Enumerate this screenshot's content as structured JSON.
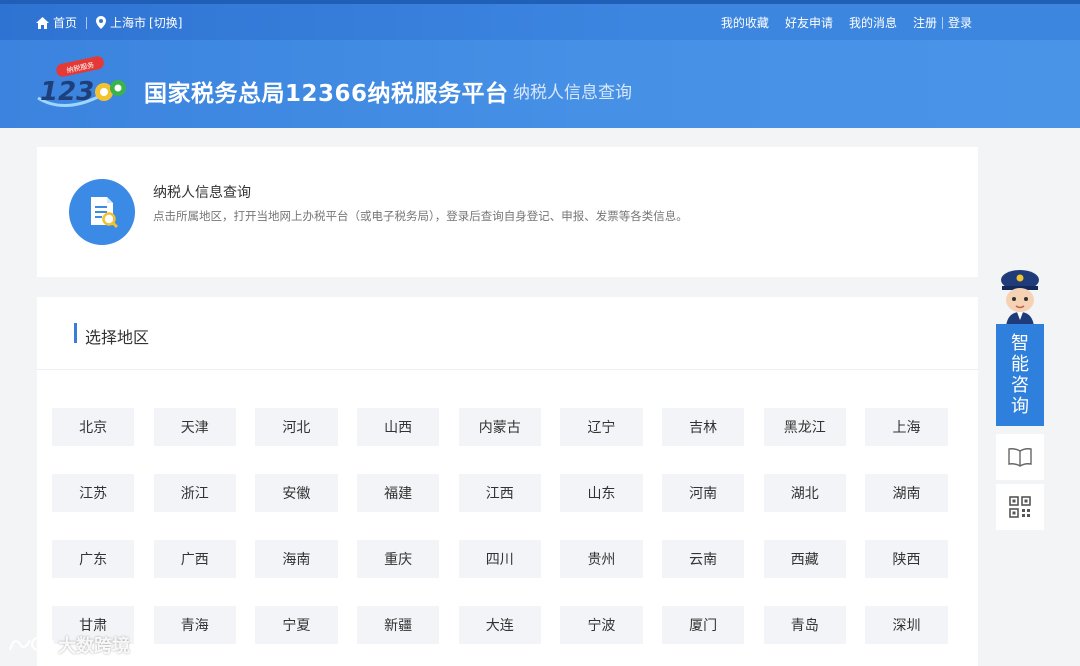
{
  "topbar": {
    "home": "首页",
    "location": "上海市",
    "switch": "[切换]",
    "favorites": "我的收藏",
    "friend_requests": "好友申请",
    "messages": "我的消息",
    "register": "注册",
    "login": "登录"
  },
  "banner": {
    "title": "国家税务总局12366纳税服务平台",
    "subtitle": "纳税人信息查询",
    "logo_badge": "纳税服务"
  },
  "info": {
    "title": "纳税人信息查询",
    "description": "点击所属地区，打开当地网上办税平台（或电子税务局），登录后查询自身登记、申报、发票等各类信息。"
  },
  "region": {
    "heading": "选择地区",
    "rows": [
      [
        "北京",
        "天津",
        "河北",
        "山西",
        "内蒙古",
        "辽宁",
        "吉林",
        "黑龙江",
        "上海"
      ],
      [
        "江苏",
        "浙江",
        "安徽",
        "福建",
        "江西",
        "山东",
        "河南",
        "湖北",
        "湖南"
      ],
      [
        "广东",
        "广西",
        "海南",
        "重庆",
        "四川",
        "贵州",
        "云南",
        "西藏",
        "陕西"
      ],
      [
        "甘肃",
        "青海",
        "宁夏",
        "新疆",
        "大连",
        "宁波",
        "厦门",
        "青岛",
        "深圳"
      ]
    ]
  },
  "side": {
    "consult": [
      "智",
      "能",
      "咨",
      "询"
    ],
    "icons": [
      "book-icon",
      "qrcode-icon"
    ]
  },
  "watermark": "大数跨境",
  "colors": {
    "primary": "#3a86e2",
    "consult": "#2f7fdc",
    "chip_bg": "#f2f4f7"
  }
}
